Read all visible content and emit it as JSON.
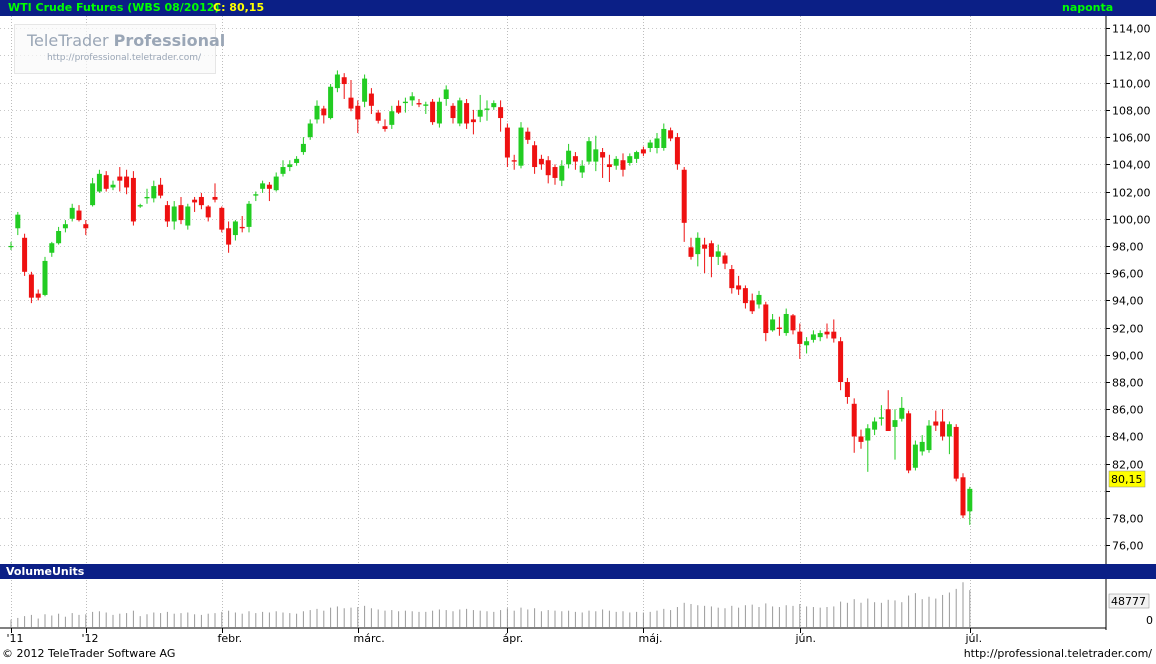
{
  "header": {
    "title": "WTI Crude Futures (WBS 08/2012)",
    "close_label": "C: 80,15",
    "period": "naponta"
  },
  "watermark": {
    "brand_light": "TeleTrader",
    "brand_bold": "Professional",
    "url": "http://professional.teletrader.com/"
  },
  "volume_panel": {
    "title": "VolumeUnits",
    "last_value_label": "48777",
    "zero_label": "0"
  },
  "footer": {
    "copyright": "© 2012 TeleTrader Software AG",
    "url": "http://professional.teletrader.com/"
  },
  "colors": {
    "header_bg": "#0b1f86",
    "title_text": "#00ff00",
    "close_text": "#ffff00",
    "up_candle": "#22cc22",
    "down_candle": "#ee1111",
    "last_price_bg": "#ffff00"
  },
  "chart_data": {
    "type": "candlestick",
    "title": "WTI Crude Futures (WBS 08/2012)",
    "last_close": 80.15,
    "last_close_label": "80,15",
    "y_axis": {
      "position": "right",
      "range": [
        74.7,
        114.9
      ],
      "ticks": [
        76,
        78,
        80,
        82,
        84,
        86,
        88,
        90,
        92,
        94,
        96,
        98,
        100,
        102,
        104,
        106,
        108,
        110,
        112,
        114
      ],
      "tick_labels": [
        "76,00",
        "78,00",
        "80,00",
        "82,00",
        "84,00",
        "86,00",
        "88,00",
        "90,00",
        "92,00",
        "94,00",
        "96,00",
        "98,00",
        "100,00",
        "102,00",
        "104,00",
        "106,00",
        "108,00",
        "110,00",
        "112,00",
        "114,00"
      ]
    },
    "x_axis": {
      "months": [
        {
          "label": "'11",
          "day_index": 0
        },
        {
          "label": "'12",
          "day_index": 11
        },
        {
          "label": "febr.",
          "day_index": 31
        },
        {
          "label": "márc.",
          "day_index": 51
        },
        {
          "label": "ápr.",
          "day_index": 73
        },
        {
          "label": "máj.",
          "day_index": 93
        },
        {
          "label": "jún.",
          "day_index": 116
        },
        {
          "label": "júl.",
          "day_index": 141
        }
      ]
    },
    "grid": true,
    "candles": [
      {
        "o": 98.0,
        "h": 98.3,
        "l": 97.7,
        "c": 98.0,
        "v": 1200
      },
      {
        "o": 99.3,
        "h": 100.5,
        "l": 98.8,
        "c": 100.3,
        "v": 1500
      },
      {
        "o": 98.6,
        "h": 98.9,
        "l": 95.8,
        "c": 96.1,
        "v": 1800
      },
      {
        "o": 95.9,
        "h": 96.1,
        "l": 93.8,
        "c": 94.2,
        "v": 2000
      },
      {
        "o": 94.5,
        "h": 94.8,
        "l": 94.0,
        "c": 94.2,
        "v": 1400
      },
      {
        "o": 94.4,
        "h": 97.2,
        "l": 94.3,
        "c": 96.9,
        "v": 2100
      },
      {
        "o": 97.5,
        "h": 98.3,
        "l": 97.2,
        "c": 98.2,
        "v": 1900
      },
      {
        "o": 98.2,
        "h": 99.4,
        "l": 98.1,
        "c": 99.1,
        "v": 2200
      },
      {
        "o": 99.3,
        "h": 99.9,
        "l": 99.0,
        "c": 99.6,
        "v": 1700
      },
      {
        "o": 100.0,
        "h": 101.1,
        "l": 99.8,
        "c": 100.8,
        "v": 2300
      },
      {
        "o": 100.6,
        "h": 101.0,
        "l": 99.8,
        "c": 99.9,
        "v": 2000
      },
      {
        "o": 99.6,
        "h": 99.9,
        "l": 98.8,
        "c": 99.3,
        "v": 2100
      },
      {
        "o": 101.0,
        "h": 103.0,
        "l": 100.9,
        "c": 102.6,
        "v": 2500
      },
      {
        "o": 102.0,
        "h": 103.6,
        "l": 101.9,
        "c": 103.3,
        "v": 2600
      },
      {
        "o": 103.2,
        "h": 103.5,
        "l": 102.0,
        "c": 102.2,
        "v": 2400
      },
      {
        "o": 102.3,
        "h": 102.8,
        "l": 102.1,
        "c": 102.5,
        "v": 2000
      },
      {
        "o": 103.1,
        "h": 103.8,
        "l": 102.0,
        "c": 102.8,
        "v": 2200
      },
      {
        "o": 103.1,
        "h": 103.6,
        "l": 101.8,
        "c": 102.3,
        "v": 2300
      },
      {
        "o": 103.0,
        "h": 103.5,
        "l": 99.5,
        "c": 99.8,
        "v": 2700
      },
      {
        "o": 100.9,
        "h": 101.1,
        "l": 100.8,
        "c": 101.0,
        "v": 1800
      },
      {
        "o": 101.5,
        "h": 102.2,
        "l": 101.1,
        "c": 101.6,
        "v": 2100
      },
      {
        "o": 101.5,
        "h": 102.8,
        "l": 101.2,
        "c": 102.4,
        "v": 2400
      },
      {
        "o": 102.5,
        "h": 103.0,
        "l": 101.5,
        "c": 101.7,
        "v": 2300
      },
      {
        "o": 101.0,
        "h": 101.3,
        "l": 99.4,
        "c": 99.8,
        "v": 2500
      },
      {
        "o": 99.8,
        "h": 101.3,
        "l": 99.2,
        "c": 100.9,
        "v": 2200
      },
      {
        "o": 101.0,
        "h": 101.6,
        "l": 99.6,
        "c": 99.9,
        "v": 2300
      },
      {
        "o": 99.5,
        "h": 101.1,
        "l": 99.2,
        "c": 100.9,
        "v": 2400
      },
      {
        "o": 101.4,
        "h": 101.6,
        "l": 100.5,
        "c": 101.2,
        "v": 2100
      },
      {
        "o": 101.6,
        "h": 101.9,
        "l": 100.7,
        "c": 101.0,
        "v": 2000
      },
      {
        "o": 100.9,
        "h": 101.0,
        "l": 99.8,
        "c": 100.1,
        "v": 2200
      },
      {
        "o": 101.6,
        "h": 102.6,
        "l": 101.2,
        "c": 101.4,
        "v": 2300
      },
      {
        "o": 100.8,
        "h": 100.9,
        "l": 99.0,
        "c": 99.2,
        "v": 2500
      },
      {
        "o": 99.3,
        "h": 99.8,
        "l": 97.5,
        "c": 98.1,
        "v": 2700
      },
      {
        "o": 98.8,
        "h": 99.9,
        "l": 98.4,
        "c": 99.8,
        "v": 2400
      },
      {
        "o": 99.4,
        "h": 100.2,
        "l": 99.0,
        "c": 99.3,
        "v": 2200
      },
      {
        "o": 99.4,
        "h": 101.3,
        "l": 99.0,
        "c": 101.1,
        "v": 2600
      },
      {
        "o": 101.7,
        "h": 102.0,
        "l": 101.3,
        "c": 101.8,
        "v": 2300
      },
      {
        "o": 102.2,
        "h": 102.8,
        "l": 101.9,
        "c": 102.6,
        "v": 2500
      },
      {
        "o": 102.5,
        "h": 102.7,
        "l": 101.3,
        "c": 102.2,
        "v": 2400
      },
      {
        "o": 102.1,
        "h": 103.4,
        "l": 102.0,
        "c": 103.1,
        "v": 2600
      },
      {
        "o": 103.3,
        "h": 104.3,
        "l": 103.1,
        "c": 103.8,
        "v": 2400
      },
      {
        "o": 103.8,
        "h": 104.3,
        "l": 103.5,
        "c": 104.0,
        "v": 2300
      },
      {
        "o": 104.1,
        "h": 104.6,
        "l": 103.9,
        "c": 104.4,
        "v": 2200
      },
      {
        "o": 104.9,
        "h": 106.0,
        "l": 104.7,
        "c": 105.5,
        "v": 2600
      },
      {
        "o": 106.0,
        "h": 107.3,
        "l": 105.8,
        "c": 107.0,
        "v": 2800
      },
      {
        "o": 107.3,
        "h": 108.7,
        "l": 107.0,
        "c": 108.3,
        "v": 3000
      },
      {
        "o": 108.1,
        "h": 108.3,
        "l": 107.0,
        "c": 107.6,
        "v": 2700
      },
      {
        "o": 107.4,
        "h": 109.9,
        "l": 107.3,
        "c": 109.7,
        "v": 3200
      },
      {
        "o": 109.6,
        "h": 110.9,
        "l": 109.3,
        "c": 110.6,
        "v": 3400
      },
      {
        "o": 110.4,
        "h": 110.7,
        "l": 108.8,
        "c": 109.9,
        "v": 3100
      },
      {
        "o": 108.9,
        "h": 110.2,
        "l": 107.9,
        "c": 108.1,
        "v": 3200
      },
      {
        "o": 108.3,
        "h": 108.7,
        "l": 106.3,
        "c": 107.3,
        "v": 3300
      },
      {
        "o": 108.6,
        "h": 110.6,
        "l": 108.2,
        "c": 110.3,
        "v": 3500
      },
      {
        "o": 109.2,
        "h": 109.6,
        "l": 107.7,
        "c": 108.3,
        "v": 3100
      },
      {
        "o": 107.8,
        "h": 108.0,
        "l": 107.0,
        "c": 107.2,
        "v": 2900
      },
      {
        "o": 106.8,
        "h": 107.3,
        "l": 106.4,
        "c": 106.6,
        "v": 2700
      },
      {
        "o": 106.9,
        "h": 108.3,
        "l": 106.6,
        "c": 107.9,
        "v": 2800
      },
      {
        "o": 108.3,
        "h": 108.7,
        "l": 107.7,
        "c": 107.8,
        "v": 2600
      },
      {
        "o": 108.5,
        "h": 108.9,
        "l": 107.8,
        "c": 108.6,
        "v": 2700
      },
      {
        "o": 108.7,
        "h": 109.3,
        "l": 108.3,
        "c": 109.0,
        "v": 2600
      },
      {
        "o": 108.5,
        "h": 108.8,
        "l": 108.2,
        "c": 108.4,
        "v": 2500
      },
      {
        "o": 108.3,
        "h": 108.6,
        "l": 107.7,
        "c": 108.4,
        "v": 2500
      },
      {
        "o": 108.6,
        "h": 108.8,
        "l": 106.9,
        "c": 107.1,
        "v": 2700
      },
      {
        "o": 107.0,
        "h": 108.9,
        "l": 106.7,
        "c": 108.6,
        "v": 2900
      },
      {
        "o": 108.8,
        "h": 109.8,
        "l": 108.3,
        "c": 109.5,
        "v": 2800
      },
      {
        "o": 108.3,
        "h": 108.5,
        "l": 107.0,
        "c": 107.4,
        "v": 2600
      },
      {
        "o": 107.0,
        "h": 108.9,
        "l": 106.8,
        "c": 108.7,
        "v": 2900
      },
      {
        "o": 108.5,
        "h": 108.8,
        "l": 106.6,
        "c": 107.0,
        "v": 3000
      },
      {
        "o": 107.3,
        "h": 108.0,
        "l": 106.2,
        "c": 107.1,
        "v": 2800
      },
      {
        "o": 107.5,
        "h": 109.1,
        "l": 107.1,
        "c": 108.0,
        "v": 2700
      },
      {
        "o": 108.0,
        "h": 108.7,
        "l": 107.2,
        "c": 108.1,
        "v": 2600
      },
      {
        "o": 108.2,
        "h": 108.7,
        "l": 108.0,
        "c": 108.5,
        "v": 2500
      },
      {
        "o": 108.2,
        "h": 108.7,
        "l": 106.4,
        "c": 107.4,
        "v": 2800
      },
      {
        "o": 106.7,
        "h": 107.0,
        "l": 103.8,
        "c": 104.5,
        "v": 3100
      },
      {
        "o": 104.3,
        "h": 104.7,
        "l": 103.6,
        "c": 104.2,
        "v": 2700
      },
      {
        "o": 103.9,
        "h": 107.1,
        "l": 103.7,
        "c": 106.7,
        "v": 3200
      },
      {
        "o": 106.4,
        "h": 106.7,
        "l": 105.5,
        "c": 105.8,
        "v": 2900
      },
      {
        "o": 105.4,
        "h": 105.7,
        "l": 103.3,
        "c": 103.8,
        "v": 3100
      },
      {
        "o": 104.4,
        "h": 104.7,
        "l": 103.6,
        "c": 104.0,
        "v": 2600
      },
      {
        "o": 104.3,
        "h": 104.6,
        "l": 102.6,
        "c": 103.2,
        "v": 2800
      },
      {
        "o": 103.8,
        "h": 104.0,
        "l": 102.5,
        "c": 103.0,
        "v": 2700
      },
      {
        "o": 102.8,
        "h": 104.3,
        "l": 102.4,
        "c": 103.9,
        "v": 2600
      },
      {
        "o": 104.0,
        "h": 105.5,
        "l": 103.7,
        "c": 105.0,
        "v": 2700
      },
      {
        "o": 104.6,
        "h": 104.9,
        "l": 103.6,
        "c": 104.2,
        "v": 2500
      },
      {
        "o": 103.4,
        "h": 104.3,
        "l": 103.0,
        "c": 103.9,
        "v": 2400
      },
      {
        "o": 104.2,
        "h": 106.0,
        "l": 104.0,
        "c": 105.7,
        "v": 2700
      },
      {
        "o": 104.2,
        "h": 106.1,
        "l": 103.5,
        "c": 105.1,
        "v": 2600
      },
      {
        "o": 104.9,
        "h": 105.2,
        "l": 103.0,
        "c": 104.5,
        "v": 2900
      },
      {
        "o": 104.0,
        "h": 104.7,
        "l": 102.7,
        "c": 103.8,
        "v": 2700
      },
      {
        "o": 103.9,
        "h": 104.6,
        "l": 103.6,
        "c": 104.4,
        "v": 2500
      },
      {
        "o": 104.3,
        "h": 104.8,
        "l": 103.1,
        "c": 103.6,
        "v": 2600
      },
      {
        "o": 104.1,
        "h": 104.8,
        "l": 103.9,
        "c": 104.6,
        "v": 2400
      },
      {
        "o": 104.4,
        "h": 105.0,
        "l": 104.1,
        "c": 104.9,
        "v": 2500
      },
      {
        "o": 105.1,
        "h": 105.3,
        "l": 104.6,
        "c": 104.8,
        "v": 2400
      },
      {
        "o": 105.2,
        "h": 105.8,
        "l": 104.9,
        "c": 105.6,
        "v": 2500
      },
      {
        "o": 105.2,
        "h": 106.3,
        "l": 104.8,
        "c": 105.9,
        "v": 2700
      },
      {
        "o": 105.2,
        "h": 107.0,
        "l": 105.0,
        "c": 106.6,
        "v": 3000
      },
      {
        "o": 106.5,
        "h": 106.7,
        "l": 105.7,
        "c": 105.9,
        "v": 2800
      },
      {
        "o": 106.0,
        "h": 106.3,
        "l": 103.6,
        "c": 104.0,
        "v": 3300
      },
      {
        "o": 103.6,
        "h": 103.8,
        "l": 98.3,
        "c": 99.7,
        "v": 4000
      },
      {
        "o": 97.9,
        "h": 98.6,
        "l": 97.0,
        "c": 97.2,
        "v": 3800
      },
      {
        "o": 97.4,
        "h": 99.0,
        "l": 96.5,
        "c": 98.6,
        "v": 3600
      },
      {
        "o": 98.1,
        "h": 98.6,
        "l": 96.0,
        "c": 97.8,
        "v": 3500
      },
      {
        "o": 98.2,
        "h": 98.4,
        "l": 95.7,
        "c": 97.2,
        "v": 3400
      },
      {
        "o": 97.2,
        "h": 98.1,
        "l": 96.6,
        "c": 97.6,
        "v": 3200
      },
      {
        "o": 97.3,
        "h": 97.5,
        "l": 96.3,
        "c": 96.7,
        "v": 3100
      },
      {
        "o": 96.3,
        "h": 96.6,
        "l": 94.5,
        "c": 94.9,
        "v": 3500
      },
      {
        "o": 95.1,
        "h": 95.8,
        "l": 94.4,
        "c": 94.8,
        "v": 3200
      },
      {
        "o": 94.9,
        "h": 95.1,
        "l": 93.4,
        "c": 93.8,
        "v": 3600
      },
      {
        "o": 94.0,
        "h": 94.5,
        "l": 93.0,
        "c": 93.2,
        "v": 3700
      },
      {
        "o": 93.7,
        "h": 94.7,
        "l": 93.4,
        "c": 94.4,
        "v": 3300
      },
      {
        "o": 93.7,
        "h": 93.9,
        "l": 91.0,
        "c": 91.6,
        "v": 3900
      },
      {
        "o": 91.8,
        "h": 93.0,
        "l": 91.7,
        "c": 92.6,
        "v": 3400
      },
      {
        "o": 92.0,
        "h": 92.8,
        "l": 91.4,
        "c": 91.9,
        "v": 3300
      },
      {
        "o": 91.6,
        "h": 93.4,
        "l": 91.4,
        "c": 93.0,
        "v": 3600
      },
      {
        "o": 92.9,
        "h": 93.0,
        "l": 91.5,
        "c": 91.8,
        "v": 3500
      },
      {
        "o": 91.7,
        "h": 92.3,
        "l": 89.7,
        "c": 90.8,
        "v": 3800
      },
      {
        "o": 90.7,
        "h": 91.3,
        "l": 90.1,
        "c": 91.0,
        "v": 3400
      },
      {
        "o": 91.1,
        "h": 91.8,
        "l": 90.9,
        "c": 91.5,
        "v": 3300
      },
      {
        "o": 91.3,
        "h": 91.8,
        "l": 91.0,
        "c": 91.6,
        "v": 3200
      },
      {
        "o": 91.7,
        "h": 92.3,
        "l": 91.2,
        "c": 91.5,
        "v": 3300
      },
      {
        "o": 91.7,
        "h": 92.6,
        "l": 90.9,
        "c": 91.2,
        "v": 3400
      },
      {
        "o": 91.0,
        "h": 91.3,
        "l": 87.4,
        "c": 88.0,
        "v": 4200
      },
      {
        "o": 88.0,
        "h": 88.3,
        "l": 86.4,
        "c": 86.9,
        "v": 4000
      },
      {
        "o": 86.4,
        "h": 86.8,
        "l": 82.8,
        "c": 84.0,
        "v": 4600
      },
      {
        "o": 84.0,
        "h": 84.5,
        "l": 83.1,
        "c": 83.6,
        "v": 4000
      },
      {
        "o": 83.7,
        "h": 84.9,
        "l": 81.4,
        "c": 84.6,
        "v": 4700
      },
      {
        "o": 84.5,
        "h": 85.4,
        "l": 84.1,
        "c": 85.1,
        "v": 4100
      },
      {
        "o": 85.3,
        "h": 86.3,
        "l": 84.8,
        "c": 85.4,
        "v": 4000
      },
      {
        "o": 86.0,
        "h": 87.4,
        "l": 84.4,
        "c": 84.4,
        "v": 4500
      },
      {
        "o": 84.7,
        "h": 86.0,
        "l": 82.3,
        "c": 85.2,
        "v": 4400
      },
      {
        "o": 85.3,
        "h": 86.9,
        "l": 85.1,
        "c": 86.1,
        "v": 4100
      },
      {
        "o": 85.7,
        "h": 85.9,
        "l": 81.3,
        "c": 81.5,
        "v": 5200
      },
      {
        "o": 81.7,
        "h": 83.7,
        "l": 81.5,
        "c": 83.4,
        "v": 5600
      },
      {
        "o": 82.9,
        "h": 84.1,
        "l": 82.6,
        "c": 83.6,
        "v": 4600
      },
      {
        "o": 83.0,
        "h": 85.2,
        "l": 82.8,
        "c": 84.8,
        "v": 5000
      },
      {
        "o": 85.1,
        "h": 85.9,
        "l": 84.4,
        "c": 84.8,
        "v": 4700
      },
      {
        "o": 85.1,
        "h": 86.0,
        "l": 83.7,
        "c": 84.0,
        "v": 5300
      },
      {
        "o": 84.0,
        "h": 85.1,
        "l": 82.7,
        "c": 84.9,
        "v": 5700
      },
      {
        "o": 84.7,
        "h": 84.9,
        "l": 80.7,
        "c": 80.9,
        "v": 6300
      },
      {
        "o": 81.0,
        "h": 81.3,
        "l": 78.0,
        "c": 78.2,
        "v": 7400
      },
      {
        "o": 78.5,
        "h": 80.3,
        "l": 77.5,
        "c": 80.15,
        "v": 6100
      }
    ]
  }
}
